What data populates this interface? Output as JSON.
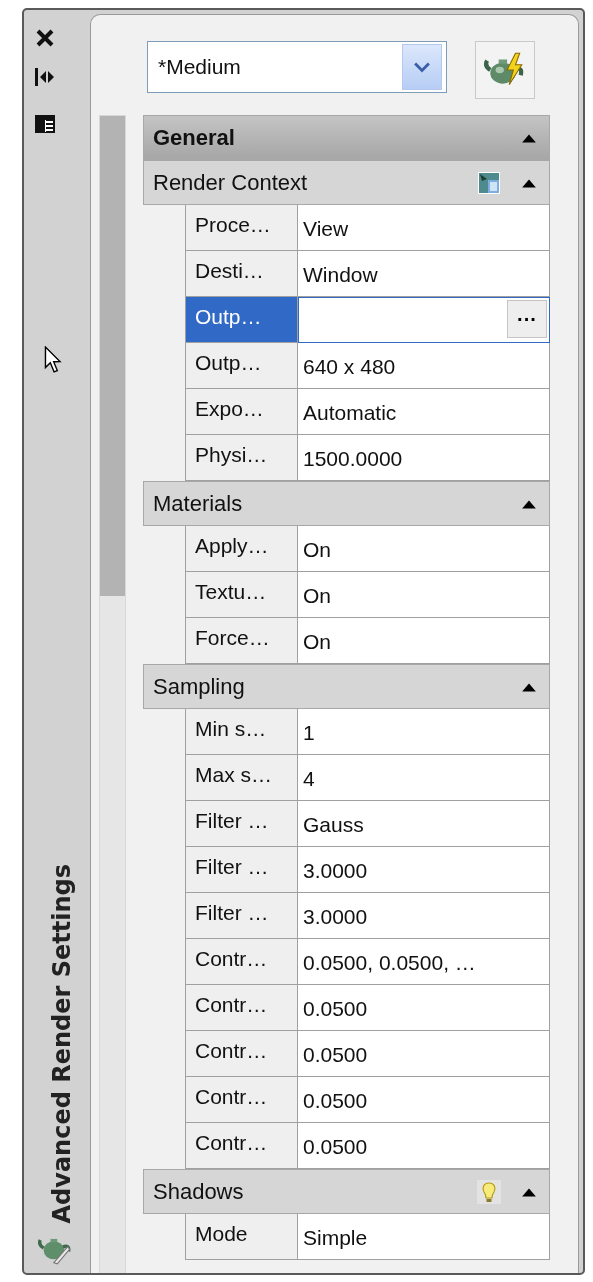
{
  "palette": {
    "title": "Advanced Render Settings"
  },
  "preset": {
    "value": "*Medium"
  },
  "sections": [
    {
      "title": "General",
      "kind": "category",
      "expanded": true
    },
    {
      "title": "Render Context",
      "kind": "section-window",
      "expanded": true,
      "rows": [
        {
          "label": "Proce…",
          "value": "View",
          "selected": false
        },
        {
          "label": "Desti…",
          "value": "Window",
          "selected": false
        },
        {
          "label": "Outp…",
          "value": "",
          "selected": true,
          "button_label": "···"
        },
        {
          "label": "Outp…",
          "value": "640 x 480",
          "selected": false
        },
        {
          "label": "Expo…",
          "value": "Automatic",
          "selected": false
        },
        {
          "label": "Physi…",
          "value": "1500.0000",
          "selected": false
        }
      ]
    },
    {
      "title": "Materials",
      "kind": "section",
      "expanded": true,
      "rows": [
        {
          "label": "Apply…",
          "value": "On",
          "selected": false
        },
        {
          "label": "Textu…",
          "value": "On",
          "selected": false
        },
        {
          "label": "Force…",
          "value": "On",
          "selected": false
        }
      ]
    },
    {
      "title": "Sampling",
      "kind": "section",
      "expanded": true,
      "rows": [
        {
          "label": "Min s…",
          "value": "1",
          "selected": false
        },
        {
          "label": "Max s…",
          "value": "4",
          "selected": false
        },
        {
          "label": "Filter …",
          "value": "Gauss",
          "selected": false
        },
        {
          "label": "Filter …",
          "value": "3.0000",
          "selected": false
        },
        {
          "label": "Filter …",
          "value": "3.0000",
          "selected": false
        },
        {
          "label": "Contr…",
          "value": "0.0500, 0.0500, …",
          "selected": false
        },
        {
          "label": "Contr…",
          "value": "0.0500",
          "selected": false
        },
        {
          "label": "Contr…",
          "value": "0.0500",
          "selected": false
        },
        {
          "label": "Contr…",
          "value": "0.0500",
          "selected": false
        },
        {
          "label": "Contr…",
          "value": "0.0500",
          "selected": false
        }
      ]
    },
    {
      "title": "Shadows",
      "kind": "section-light",
      "expanded": true,
      "rows": [
        {
          "label": "Mode",
          "value": "Simple",
          "selected": false
        }
      ]
    }
  ]
}
